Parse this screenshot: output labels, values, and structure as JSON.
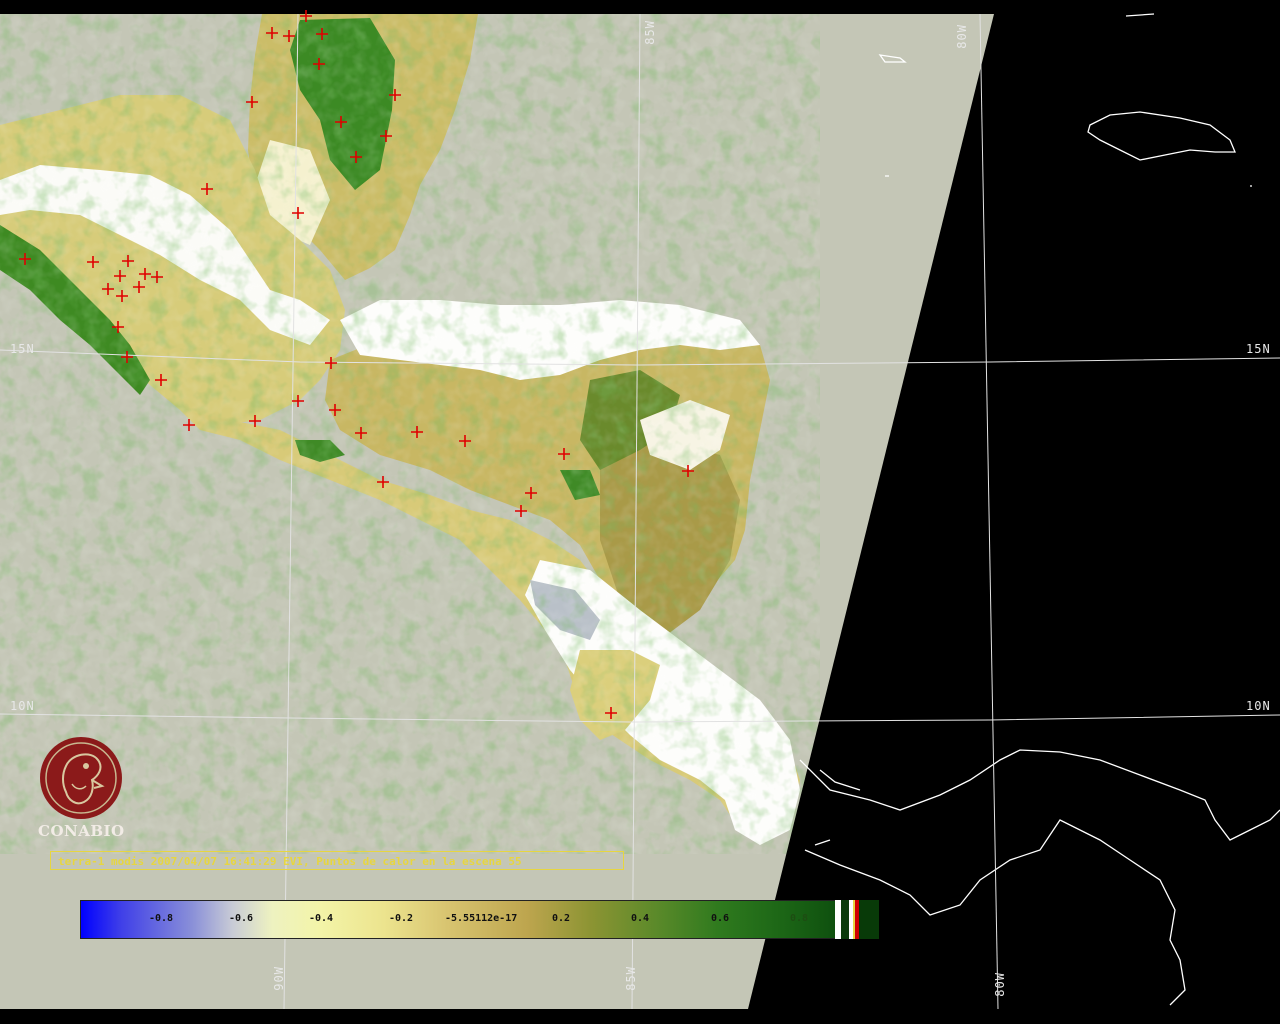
{
  "map": {
    "grid_labels": {
      "lat_15_left": "15N",
      "lat_15_right": "15N",
      "lat_10_left": "10N",
      "lat_10_right": "10N",
      "lon_85_top": "85W",
      "lon_80_top": "80W",
      "lon_90_bottom": "90W",
      "lon_85_bottom": "85W",
      "lon_80_bottom": "80W"
    },
    "colors": {
      "ocean": "#c4c6b6",
      "night": "#000000",
      "cloud": "#ffffff",
      "vegetation_dense": "#2e7d1f",
      "vegetation_mid": "#c9bb6a",
      "vegetation_low": "#efe9a6",
      "fire_marker": "#e00000",
      "coastline": "#ffffff",
      "gridline": "#e0e0e0"
    }
  },
  "logo": {
    "name": "CONABIO",
    "color": "#8b1a1a"
  },
  "caption": {
    "text": "terra-1 modis 2007/04/07 16:41:29 EVI, Puntos de calor en la escena 55"
  },
  "colorbar": {
    "ticks": [
      "-0.8",
      "-0.6",
      "-0.4",
      "-0.2",
      "-5.55112e-17",
      "0.2",
      "0.4",
      "0.6",
      "0.8"
    ]
  },
  "fire_points": [
    [
      306,
      16
    ],
    [
      272,
      33
    ],
    [
      289,
      36
    ],
    [
      322,
      34
    ],
    [
      319,
      64
    ],
    [
      395,
      95
    ],
    [
      252,
      102
    ],
    [
      341,
      122
    ],
    [
      386,
      136
    ],
    [
      356,
      157
    ],
    [
      207,
      189
    ],
    [
      298,
      213
    ],
    [
      25,
      259
    ],
    [
      93,
      262
    ],
    [
      128,
      261
    ],
    [
      145,
      274
    ],
    [
      157,
      277
    ],
    [
      120,
      276
    ],
    [
      139,
      287
    ],
    [
      108,
      289
    ],
    [
      122,
      296
    ],
    [
      118,
      327
    ],
    [
      127,
      357
    ],
    [
      161,
      380
    ],
    [
      331,
      363
    ],
    [
      298,
      401
    ],
    [
      335,
      410
    ],
    [
      255,
      421
    ],
    [
      189,
      425
    ],
    [
      361,
      433
    ],
    [
      417,
      432
    ],
    [
      465,
      441
    ],
    [
      564,
      454
    ],
    [
      688,
      471
    ],
    [
      383,
      482
    ],
    [
      531,
      493
    ],
    [
      521,
      511
    ],
    [
      611,
      713
    ]
  ]
}
